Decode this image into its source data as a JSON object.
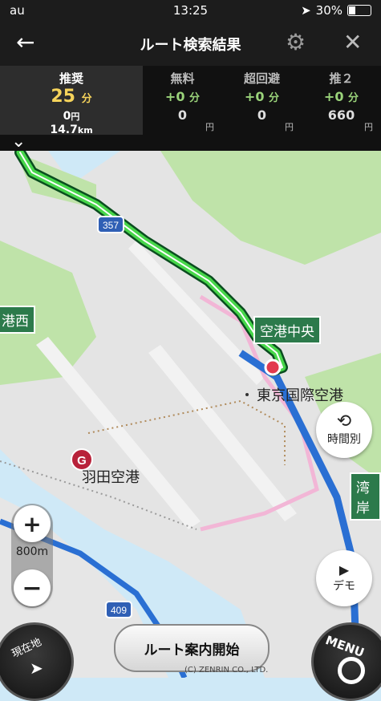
{
  "status_bar": {
    "carrier": "au",
    "time": "13:25",
    "battery": "30%"
  },
  "nav": {
    "title": "ルート検索結果",
    "back_icon": "←",
    "close_icon": "✕"
  },
  "routes": [
    {
      "name": "推奨",
      "minutes": "25",
      "min_unit": "分",
      "toll": "0",
      "toll_unit": "円",
      "distance": "14.7",
      "distance_unit": "km"
    },
    {
      "name": "無料",
      "diff": "+0",
      "diff_unit": "分",
      "toll": "0",
      "toll_unit": "円"
    },
    {
      "name": "超回避",
      "diff": "+0",
      "diff_unit": "分",
      "toll": "0",
      "toll_unit": "円"
    },
    {
      "name": "推２",
      "diff": "+0",
      "diff_unit": "分",
      "toll": "660",
      "toll_unit": "円"
    }
  ],
  "map": {
    "labels": {
      "airport_center": "空港中央",
      "tokyo_intl": "東京国際空港",
      "haneda": "羽田空港",
      "minato_west": "港西",
      "wan": "湾岸",
      "route_357": "357",
      "route_409": "409",
      "goal_marker": "G"
    },
    "copyright": "(C) ZENRIN CO., LTD."
  },
  "controls": {
    "time_button": "時間別",
    "demo_button": "デモ",
    "zoom_scale": "800m",
    "start_button": "ルート案内開始",
    "current_location": "現在地",
    "menu": "MENU"
  }
}
